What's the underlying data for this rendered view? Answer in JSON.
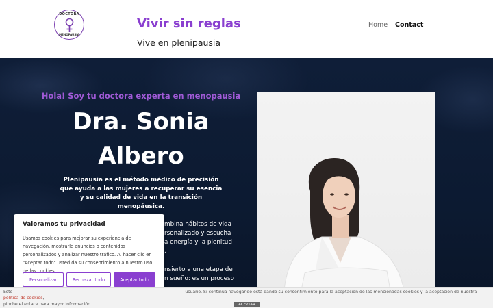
{
  "logo": {
    "top_text": "DOCTORA",
    "bottom_text": "MENOPAUSIA",
    "icon": "female-symbol-icon"
  },
  "site": {
    "title": "Vivir sin reglas",
    "tagline": "Vive en plenipausia"
  },
  "nav": {
    "home": "Home",
    "contact": "Contact"
  },
  "hero": {
    "subtitle": "Hola! Soy tu doctora experta en menopausia",
    "name_line1": "Dra. Sonia",
    "name_line2": "Albero",
    "description": "Plenipausia es el método médico de precisión que ayuda a las mujeres a recuperar su esencia y su calidad de vida en la transición menopáusica.",
    "text2_lines": [
      "mbina hábitos de vida",
      "rsonalizado y escucha",
      "a energía y la plenitud",
      "."
    ],
    "text3_lines": [
      "nsierto a una etapa de",
      "n sueño: es un proceso"
    ]
  },
  "cookie_box": {
    "title": "Valoramos tu privacidad",
    "text": "Usamos cookies para mejorar su experiencia de navegación, mostrarle anuncios o contenidos personalizados y analizar nuestro tráfico. Al hacer clic en \"Aceptar todo\" usted da su consentimiento a nuestro uso de las cookies.",
    "customize": "Personalizar",
    "reject": "Rechazar todo",
    "accept": "Aceptar todo"
  },
  "cookie_bar": {
    "text_start": "Este",
    "text_main": "usuario. Si continúa navegando está dando su consentimiento para la aceptación de las mencionadas cookies y la aceptación de nuestra",
    "link": "política de cookies",
    "text_end": ",",
    "line2": "pinche el enlace para mayor información.",
    "accept": "ACEPTAR"
  },
  "colors": {
    "accent": "#8a3fd0",
    "hero_bg": "#0f1e38"
  }
}
